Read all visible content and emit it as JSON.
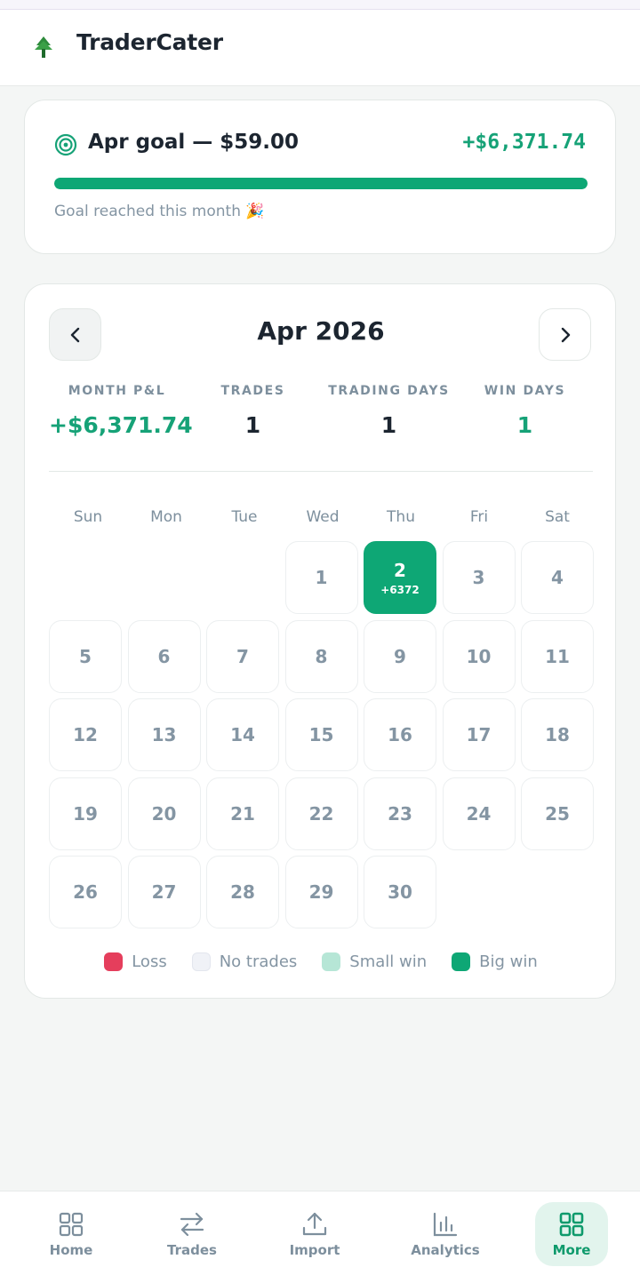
{
  "app": {
    "name": "TraderCater"
  },
  "goal": {
    "title": "Apr goal — $59.00",
    "amount": "+$6,371.74",
    "progress": 1.0,
    "note": "Goal reached this month 🎉"
  },
  "calendar": {
    "month_title": "Apr 2026",
    "stats": [
      {
        "label": "MONTH P&L",
        "value": "+$6,371.74",
        "tone": "green"
      },
      {
        "label": "TRADES",
        "value": "1",
        "tone": "dark"
      },
      {
        "label": "TRADING DAYS",
        "value": "1",
        "tone": "dark"
      },
      {
        "label": "WIN DAYS",
        "value": "1",
        "tone": "green"
      }
    ],
    "weekdays": [
      "Sun",
      "Mon",
      "Tue",
      "Wed",
      "Thu",
      "Fri",
      "Sat"
    ],
    "first_weekday_index": 3,
    "days_in_month": 30,
    "day_results": {
      "2": {
        "pnl": "+6372",
        "type": "big-win"
      }
    },
    "legend": [
      {
        "label": "Loss",
        "color": "#e53e5c"
      },
      {
        "label": "No trades",
        "color": "#f0f2f7"
      },
      {
        "label": "Small win",
        "color": "#b6e6d6"
      },
      {
        "label": "Big win",
        "color": "#0ea775"
      }
    ]
  },
  "bottom_nav": [
    {
      "label": "Home",
      "icon": "grid-icon",
      "active": false
    },
    {
      "label": "Trades",
      "icon": "swap-arrows-icon",
      "active": false
    },
    {
      "label": "Import",
      "icon": "upload-icon",
      "active": false
    },
    {
      "label": "Analytics",
      "icon": "bar-chart-icon",
      "active": false
    },
    {
      "label": "More",
      "icon": "apps-icon",
      "active": true
    }
  ]
}
